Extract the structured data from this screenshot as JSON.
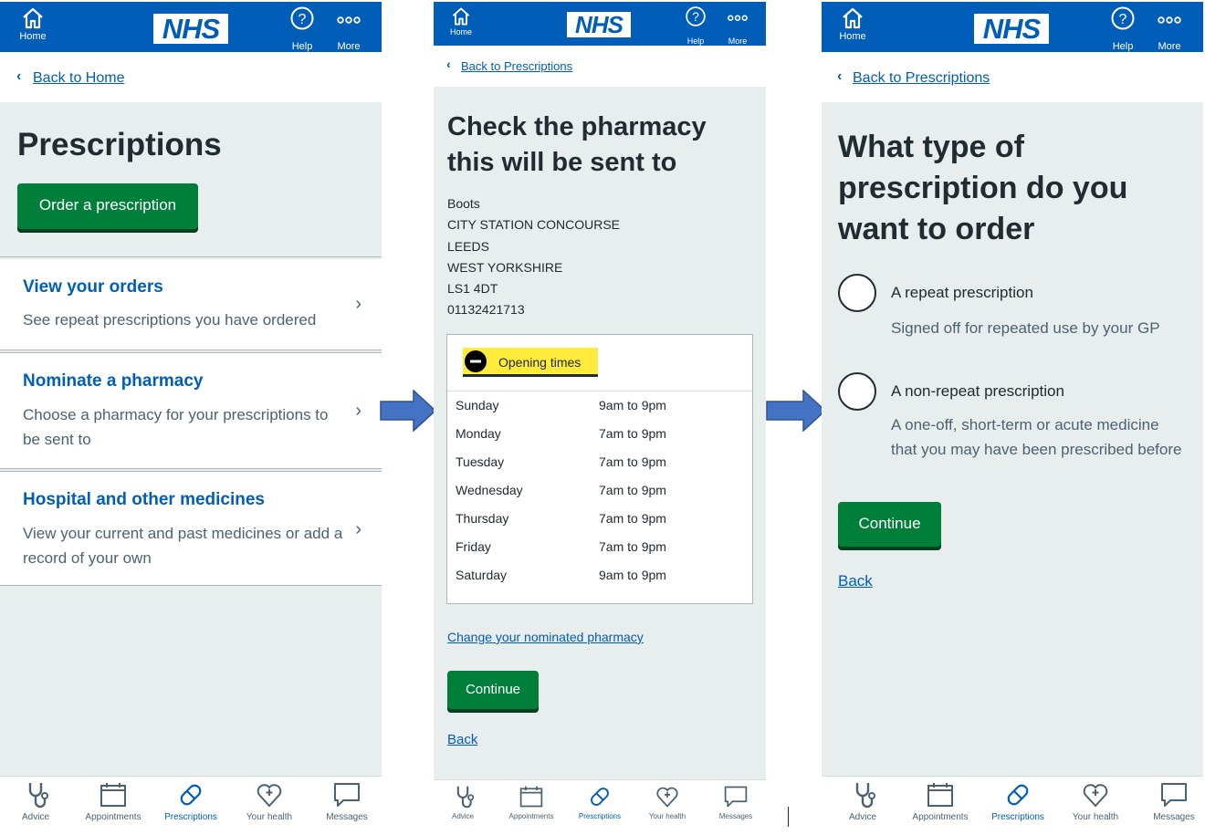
{
  "header": {
    "home_label": "Home",
    "logo_text": "NHS",
    "help_label": "Help",
    "more_label": "More",
    "brand_color": "#005eb8"
  },
  "tabbar": {
    "items": [
      {
        "label": "Advice",
        "icon": "stethoscope-icon"
      },
      {
        "label": "Appointments",
        "icon": "calendar-icon"
      },
      {
        "label": "Prescriptions",
        "icon": "pill-icon"
      },
      {
        "label": "Your health",
        "icon": "heart-icon"
      },
      {
        "label": "Messages",
        "icon": "chat-icon"
      }
    ],
    "active": "Prescriptions"
  },
  "screen1": {
    "back_link": "Back to Home",
    "title": "Prescriptions",
    "order_button": "Order a prescription",
    "cards": [
      {
        "title": "View your orders",
        "description": "See repeat prescriptions you have ordered"
      },
      {
        "title": "Nominate a pharmacy",
        "description": "Choose a pharmacy for your prescriptions to be sent to"
      },
      {
        "title": "Hospital and other medicines",
        "description": "View your current and past medicines or add a record of your own"
      }
    ]
  },
  "screen2": {
    "back_link": "Back to Prescriptions",
    "title_line1": "Check the pharmacy",
    "title_line2": "this will be sent to",
    "address": [
      "Boots",
      "CITY STATION CONCOURSE",
      "LEEDS",
      "WEST YORKSHIRE",
      "LS1 4DT",
      "01132421713"
    ],
    "opening_times_label": "Opening times",
    "opening_times": [
      {
        "day": "Sunday",
        "hours": "9am to 9pm"
      },
      {
        "day": "Monday",
        "hours": "7am to 9pm"
      },
      {
        "day": "Tuesday",
        "hours": "7am to 9pm"
      },
      {
        "day": "Wednesday",
        "hours": "7am to 9pm"
      },
      {
        "day": "Thursday",
        "hours": "7am to 9pm"
      },
      {
        "day": "Friday",
        "hours": "7am to 9pm"
      },
      {
        "day": "Saturday",
        "hours": "9am to 9pm"
      }
    ],
    "change_link": "Change your nominated pharmacy",
    "continue_button": "Continue",
    "back": "Back"
  },
  "screen3": {
    "back_link": "Back to Prescriptions",
    "title_line1": "What type of",
    "title_line2": "prescription do you",
    "title_line3": "want to order",
    "options": [
      {
        "label": "A repeat prescription",
        "hint": "Signed off for repeated use by your GP"
      },
      {
        "label": "A non-repeat prescription",
        "hint": "A one-off, short-term or acute medicine that you may have been prescribed before"
      }
    ],
    "continue_button": "Continue",
    "back": "Back"
  }
}
